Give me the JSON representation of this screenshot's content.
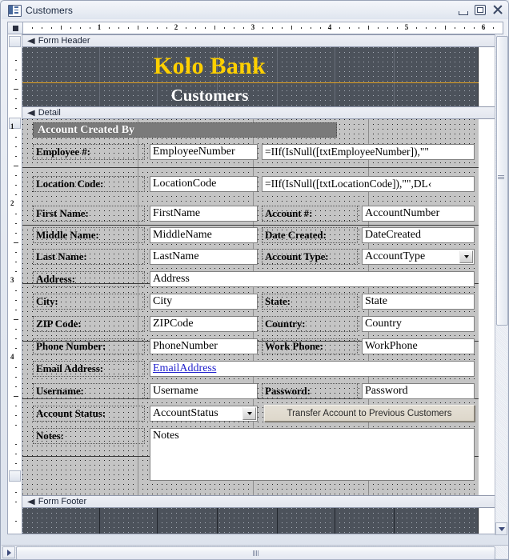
{
  "window": {
    "title": "Customers",
    "icon": "form-design-icon",
    "minimize_label": "Minimize",
    "restore_label": "Restore",
    "close_label": "Close"
  },
  "rulers": {
    "horizontal_numbers": [
      "1",
      "2",
      "3",
      "4",
      "5",
      "6"
    ],
    "vertical_numbers": [
      "1",
      "2",
      "3",
      "4"
    ]
  },
  "sections": {
    "form_header": "Form Header",
    "detail": "Detail",
    "form_footer": "Form Footer"
  },
  "header": {
    "bank_name": "Kolo Bank",
    "subtitle": "Customers"
  },
  "detail": {
    "group_header": "Account Created By",
    "rows": [
      {
        "label": "Employee #:",
        "field": "EmployeeNumber",
        "expr": "=IIf(IsNull([txtEmployeeNumber]),\"\""
      },
      {
        "label": "Location Code:",
        "field": "LocationCode",
        "expr": "=IIf(IsNull([txtLocationCode]),\"\",DL‹"
      }
    ],
    "left_fields": [
      {
        "label": "First Name:",
        "value": "FirstName"
      },
      {
        "label": "Middle Name:",
        "value": "MiddleName"
      },
      {
        "label": "Last Name:",
        "value": "LastName"
      },
      {
        "label": "Address:",
        "value": "Address"
      },
      {
        "label": "City:",
        "value": "City"
      },
      {
        "label": "ZIP Code:",
        "value": "ZIPCode"
      },
      {
        "label": "Phone Number:",
        "value": "PhoneNumber"
      },
      {
        "label": "Email Address:",
        "value": "EmailAddress"
      },
      {
        "label": "Username:",
        "value": "Username"
      },
      {
        "label": "Account Status:",
        "value": "AccountStatus"
      },
      {
        "label": "Notes:",
        "value": "Notes"
      }
    ],
    "right_fields": [
      {
        "label": "Account #:",
        "value": "AccountNumber"
      },
      {
        "label": "Date Created:",
        "value": "DateCreated"
      },
      {
        "label": "Account Type:",
        "value": "AccountType"
      },
      {
        "label": "State:",
        "value": "State"
      },
      {
        "label": "Country:",
        "value": "Country"
      },
      {
        "label": "Work Phone:",
        "value": "WorkPhone"
      },
      {
        "label": "Password:",
        "value": "Password"
      }
    ],
    "transfer_button": "Transfer Account to Previous Customers"
  },
  "colors": {
    "accent_gold": "#ffd000",
    "header_canvas": "#4c525b",
    "detail_canvas": "#c4c4c4",
    "group_band": "#7a7a7a",
    "hyperlink": "#2222cc"
  }
}
